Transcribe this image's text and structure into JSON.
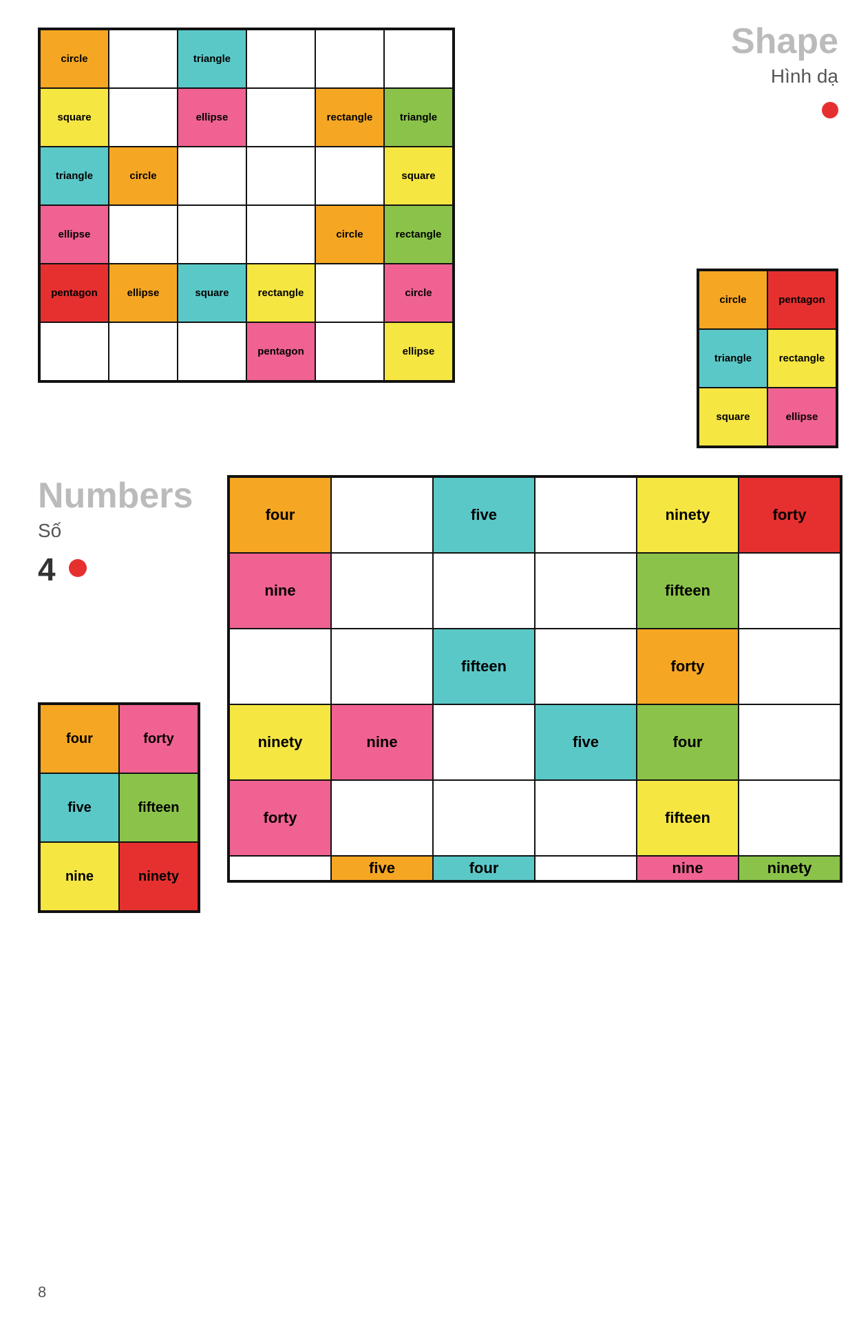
{
  "shapesSection": {
    "title": "Shape",
    "subtitle": "Hình dạ",
    "mainGrid": [
      {
        "text": "circle",
        "bg": "orange",
        "row": 1,
        "col": 1
      },
      {
        "text": "",
        "bg": "white",
        "row": 1,
        "col": 2
      },
      {
        "text": "triangle",
        "bg": "teal",
        "row": 1,
        "col": 3
      },
      {
        "text": "",
        "bg": "white",
        "row": 1,
        "col": 4
      },
      {
        "text": "",
        "bg": "white",
        "row": 1,
        "col": 5
      },
      {
        "text": "",
        "bg": "white",
        "row": 1,
        "col": 6
      },
      {
        "text": "square",
        "bg": "yellow",
        "row": 2,
        "col": 1
      },
      {
        "text": "",
        "bg": "white",
        "row": 2,
        "col": 2
      },
      {
        "text": "ellipse",
        "bg": "pink",
        "row": 2,
        "col": 3
      },
      {
        "text": "",
        "bg": "white",
        "row": 2,
        "col": 4
      },
      {
        "text": "rectangle",
        "bg": "orange",
        "row": 2,
        "col": 5
      },
      {
        "text": "triangle",
        "bg": "green",
        "row": 2,
        "col": 6
      },
      {
        "text": "triangle",
        "bg": "teal",
        "row": 3,
        "col": 1
      },
      {
        "text": "circle",
        "bg": "orange",
        "row": 3,
        "col": 2
      },
      {
        "text": "",
        "bg": "white",
        "row": 3,
        "col": 3
      },
      {
        "text": "",
        "bg": "white",
        "row": 3,
        "col": 4
      },
      {
        "text": "",
        "bg": "white",
        "row": 3,
        "col": 5
      },
      {
        "text": "square",
        "bg": "yellow",
        "row": 3,
        "col": 6
      },
      {
        "text": "ellipse",
        "bg": "pink",
        "row": 4,
        "col": 1
      },
      {
        "text": "",
        "bg": "white",
        "row": 4,
        "col": 2
      },
      {
        "text": "",
        "bg": "white",
        "row": 4,
        "col": 3
      },
      {
        "text": "",
        "bg": "white",
        "row": 4,
        "col": 4
      },
      {
        "text": "circle",
        "bg": "orange",
        "row": 4,
        "col": 5
      },
      {
        "text": "rectangle",
        "bg": "green",
        "row": 4,
        "col": 6
      },
      {
        "text": "pentagon",
        "bg": "red",
        "row": 5,
        "col": 1
      },
      {
        "text": "ellipse",
        "bg": "orange",
        "row": 5,
        "col": 2
      },
      {
        "text": "square",
        "bg": "teal",
        "row": 5,
        "col": 3
      },
      {
        "text": "rectangle",
        "bg": "yellow",
        "row": 5,
        "col": 4
      },
      {
        "text": "",
        "bg": "white",
        "row": 5,
        "col": 5
      },
      {
        "text": "circle",
        "bg": "pink",
        "row": 5,
        "col": 6
      },
      {
        "text": "",
        "bg": "white",
        "row": 6,
        "col": 1
      },
      {
        "text": "",
        "bg": "white",
        "row": 6,
        "col": 2
      },
      {
        "text": "",
        "bg": "white",
        "row": 6,
        "col": 3
      },
      {
        "text": "pentagon",
        "bg": "pink",
        "row": 6,
        "col": 4
      },
      {
        "text": "",
        "bg": "white",
        "row": 6,
        "col": 5
      },
      {
        "text": "ellipse",
        "bg": "yellow",
        "row": 6,
        "col": 6
      }
    ],
    "smallGrid": [
      {
        "text": "circle",
        "bg": "orange"
      },
      {
        "text": "pentagon",
        "bg": "red"
      },
      {
        "text": "triangle",
        "bg": "teal"
      },
      {
        "text": "rectangle",
        "bg": "yellow"
      },
      {
        "text": "square",
        "bg": "yellow"
      },
      {
        "text": "ellipse",
        "bg": "pink"
      }
    ]
  },
  "numbersSection": {
    "title": "Numbers",
    "subtitle": "Số",
    "digit": "4",
    "bigGrid": [
      {
        "text": "four",
        "bg": "orange"
      },
      {
        "text": "",
        "bg": "white"
      },
      {
        "text": "five",
        "bg": "teal"
      },
      {
        "text": "",
        "bg": "white"
      },
      {
        "text": "ninety",
        "bg": "yellow"
      },
      {
        "text": "forty",
        "bg": "red"
      },
      {
        "text": "nine",
        "bg": "pink"
      },
      {
        "text": "",
        "bg": "white"
      },
      {
        "text": "",
        "bg": "white"
      },
      {
        "text": "",
        "bg": "white"
      },
      {
        "text": "fifteen",
        "bg": "green"
      },
      {
        "text": "",
        "bg": "white"
      },
      {
        "text": "",
        "bg": "white"
      },
      {
        "text": "",
        "bg": "white"
      },
      {
        "text": "fifteen",
        "bg": "teal"
      },
      {
        "text": "",
        "bg": "white"
      },
      {
        "text": "forty",
        "bg": "orange"
      },
      {
        "text": "",
        "bg": "white"
      },
      {
        "text": "ninety",
        "bg": "yellow"
      },
      {
        "text": "nine",
        "bg": "pink"
      },
      {
        "text": "",
        "bg": "white"
      },
      {
        "text": "five",
        "bg": "teal"
      },
      {
        "text": "four",
        "bg": "green"
      },
      {
        "text": "",
        "bg": "white"
      },
      {
        "text": "forty",
        "bg": "pink"
      },
      {
        "text": "",
        "bg": "white"
      },
      {
        "text": "",
        "bg": "white"
      },
      {
        "text": "",
        "bg": "white"
      },
      {
        "text": "fifteen",
        "bg": "yellow"
      },
      {
        "text": "",
        "bg": "white"
      },
      {
        "text": "",
        "bg": "white"
      },
      {
        "text": "five",
        "bg": "orange"
      },
      {
        "text": "four",
        "bg": "teal"
      },
      {
        "text": "",
        "bg": "white"
      },
      {
        "text": "nine",
        "bg": "pink"
      },
      {
        "text": "ninety",
        "bg": "green"
      }
    ],
    "smallGrid": [
      {
        "text": "four",
        "bg": "orange"
      },
      {
        "text": "forty",
        "bg": "pink"
      },
      {
        "text": "five",
        "bg": "teal"
      },
      {
        "text": "fifteen",
        "bg": "green"
      },
      {
        "text": "nine",
        "bg": "yellow"
      },
      {
        "text": "ninety",
        "bg": "red"
      }
    ]
  },
  "pageNumber": "8"
}
